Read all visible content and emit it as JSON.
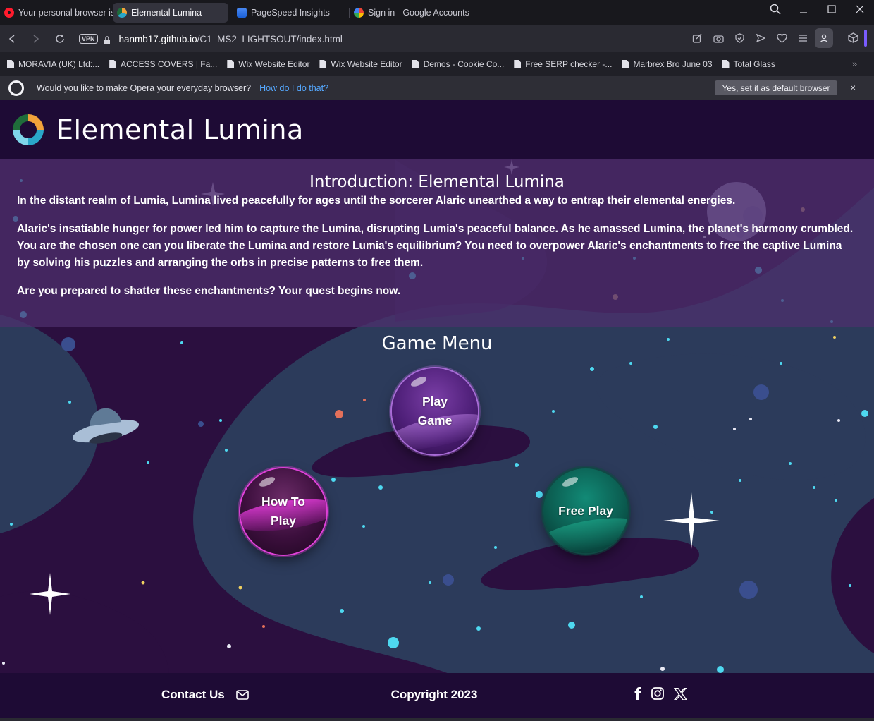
{
  "browser": {
    "tabs": [
      {
        "title": "Your personal browser is",
        "icon": "opera-icon",
        "active": false
      },
      {
        "title": "Elemental Lumina",
        "icon": "elemental-lumina-icon",
        "active": true
      },
      {
        "title": "PageSpeed Insights",
        "icon": "pagespeed-icon",
        "active": false
      },
      {
        "title": "Sign in - Google Accounts",
        "icon": "google-icon",
        "active": false
      }
    ],
    "new_tab": "+",
    "vpn_label": "VPN",
    "url_host": "hanmb17.github.io",
    "url_path": "/C1_MS2_LIGHTSOUT/index.html",
    "bookmarks": [
      "MORAVIA (UK) Ltd:...",
      "ACCESS COVERS | Fa...",
      "Wix Website Editor",
      "Wix Website Editor",
      "Demos - Cookie Co...",
      "Free SERP checker -...",
      "Marbrex Bro June 03",
      "Total Glass"
    ],
    "bookmarks_more": "»",
    "infobar": {
      "message": "Would you like to make Opera your everyday browser?",
      "link": "How do I do that?",
      "button": "Yes, set it as default browser",
      "close": "×"
    }
  },
  "site": {
    "brand": "Elemental Lumina",
    "intro_title": "Introduction: Elemental Lumina",
    "intro_p1": "In the distant realm of Lumia, Lumina lived peacefully for ages until the sorcerer Alaric unearthed a way to entrap their elemental energies.",
    "intro_p2": "Alaric's insatiable hunger for power led him to capture the Lumina, disrupting Lumia's peaceful balance. As he amassed Lumina, the planet's harmony crumbled. You are the chosen one can you liberate the Lumina and restore Lumia's equilibrium? You need to overpower Alaric's enchantments to free the captive Lumina by solving his puzzles and arranging the orbs in precise patterns to free them.",
    "intro_p3": "Are you prepared to shatter these enchantments? Your quest begins now.",
    "menu_title": "Game Menu",
    "menu": {
      "play_line1": "Play",
      "play_line2": "Game",
      "how_line1": "How To",
      "how_line2": "Play",
      "free": "Free Play"
    },
    "footer": {
      "contact": "Contact Us",
      "copyright": "Copyright 2023",
      "socials": [
        "facebook-icon",
        "instagram-icon",
        "x-icon"
      ]
    }
  },
  "colors": {
    "header_bg": "#1e0b35",
    "sky_bg": "#2c3b5b",
    "swirl": "#2b0f3f",
    "intro_overlay": "#4e2f6e",
    "orb_play": "#5a2890",
    "orb_how": "#e040d8",
    "orb_free": "#0b6b5c",
    "link": "#55a8ff"
  }
}
